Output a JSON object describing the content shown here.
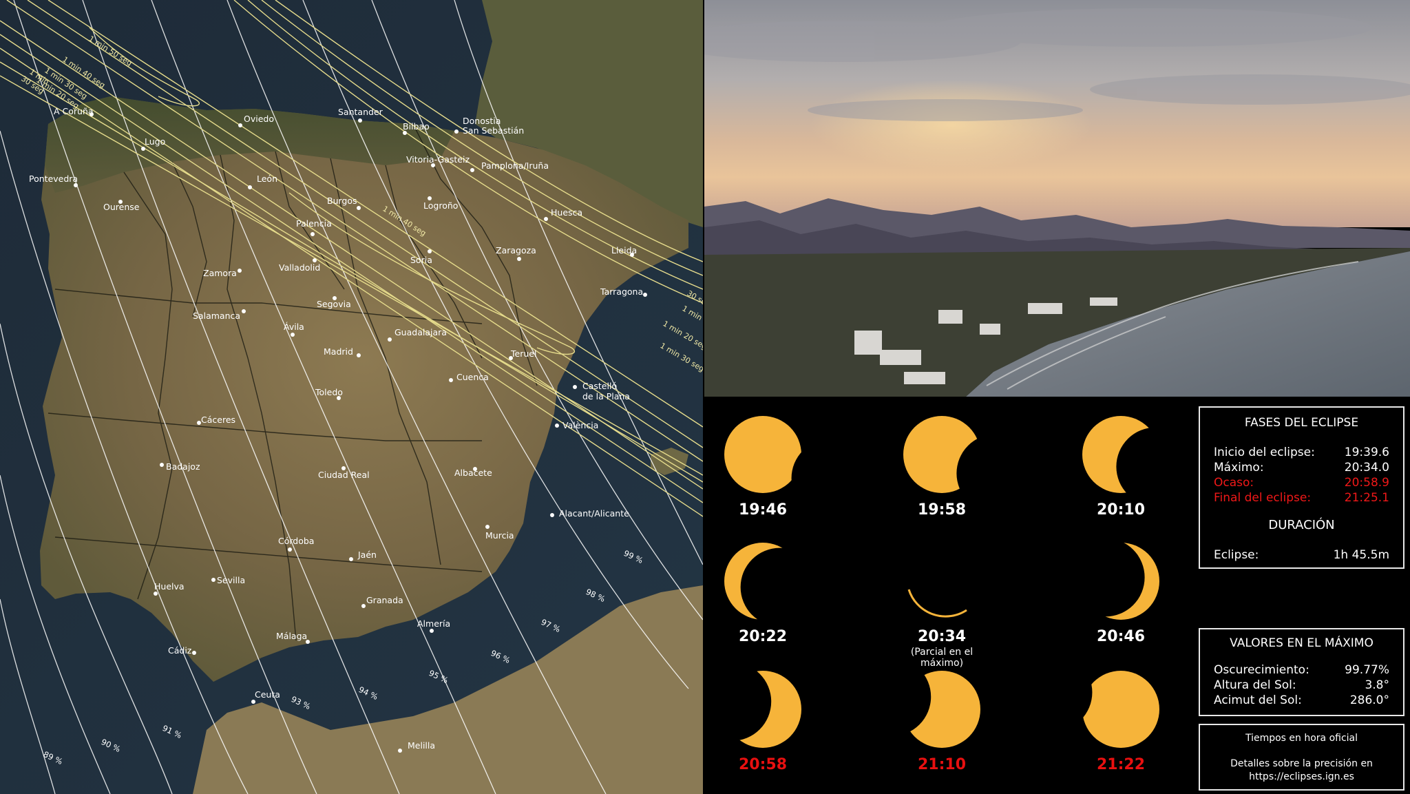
{
  "map": {
    "cities": [
      {
        "id": "a-coruna",
        "label": "A Coruña"
      },
      {
        "id": "oviedo",
        "label": "Oviedo"
      },
      {
        "id": "santander",
        "label": "Santander"
      },
      {
        "id": "bilbao",
        "label": "Bilbao"
      },
      {
        "id": "donostia",
        "label": "Donostia"
      },
      {
        "id": "san-sebastian",
        "label": "San Sebastián"
      },
      {
        "id": "lugo",
        "label": "Lugo"
      },
      {
        "id": "vitoria",
        "label": "Vitoria-Gasteiz"
      },
      {
        "id": "pamplona",
        "label": "Pamplona/Iruña"
      },
      {
        "id": "pontevedra",
        "label": "Pontevedra"
      },
      {
        "id": "leon",
        "label": "León"
      },
      {
        "id": "ourense",
        "label": "Ourense"
      },
      {
        "id": "burgos",
        "label": "Burgos"
      },
      {
        "id": "logrono",
        "label": "Logroño"
      },
      {
        "id": "huesca",
        "label": "Huesca"
      },
      {
        "id": "palencia",
        "label": "Palencia"
      },
      {
        "id": "lleida",
        "label": "Lleida"
      },
      {
        "id": "zaragoza",
        "label": "Zaragoza"
      },
      {
        "id": "soria",
        "label": "Soria"
      },
      {
        "id": "zamora",
        "label": "Zamora"
      },
      {
        "id": "valladolid",
        "label": "Valladolid"
      },
      {
        "id": "tarragona",
        "label": "Tarragona"
      },
      {
        "id": "segovia",
        "label": "Segovia"
      },
      {
        "id": "salamanca",
        "label": "Salamanca"
      },
      {
        "id": "guadalajara",
        "label": "Guadalajara"
      },
      {
        "id": "avila",
        "label": "Ávila"
      },
      {
        "id": "madrid",
        "label": "Madrid"
      },
      {
        "id": "teruel",
        "label": "Teruel"
      },
      {
        "id": "cuenca",
        "label": "Cuenca"
      },
      {
        "id": "castello",
        "label": "Castelló"
      },
      {
        "id": "de-la-plana",
        "label": "de la Plana"
      },
      {
        "id": "toledo",
        "label": "Toledo"
      },
      {
        "id": "caceres",
        "label": "Cáceres"
      },
      {
        "id": "valencia",
        "label": "València"
      },
      {
        "id": "badajoz",
        "label": "Badajoz"
      },
      {
        "id": "ciudad-real",
        "label": "Ciudad Real"
      },
      {
        "id": "albacete",
        "label": "Albacete"
      },
      {
        "id": "alicante",
        "label": "Alacant/Alicante"
      },
      {
        "id": "murcia",
        "label": "Murcia"
      },
      {
        "id": "cordoba",
        "label": "Córdoba"
      },
      {
        "id": "jaen",
        "label": "Jaén"
      },
      {
        "id": "sevilla",
        "label": "Sevilla"
      },
      {
        "id": "huelva",
        "label": "Huelva"
      },
      {
        "id": "granada",
        "label": "Granada"
      },
      {
        "id": "almeria",
        "label": "Almería"
      },
      {
        "id": "malaga",
        "label": "Málaga"
      },
      {
        "id": "cadiz",
        "label": "Cádiz"
      },
      {
        "id": "ceuta",
        "label": "Ceuta"
      },
      {
        "id": "melilla",
        "label": "Melilla"
      }
    ],
    "duration_labels": [
      {
        "id": "nw-1m50",
        "label": "1 min 50 seg"
      },
      {
        "id": "nw-1m40",
        "label": "1 min 40 seg"
      },
      {
        "id": "nw-1m30",
        "label": "1 min 30 seg"
      },
      {
        "id": "nw-1m20",
        "label": "1 min 20 seg"
      },
      {
        "id": "nw-1m10",
        "label": "1 min"
      },
      {
        "id": "nw-30",
        "label": "30 seg"
      },
      {
        "id": "center-1m40",
        "label": "1 min 40 seg"
      },
      {
        "id": "e-30",
        "label": "30 seg"
      },
      {
        "id": "e-1m",
        "label": "1 min"
      },
      {
        "id": "e-1m20",
        "label": "1 min 20 seg"
      },
      {
        "id": "e-1m30",
        "label": "1 min 30 seg"
      }
    ],
    "obscuration_labels": [
      {
        "id": "p99",
        "label": "99 %"
      },
      {
        "id": "p98",
        "label": "98 %"
      },
      {
        "id": "p97",
        "label": "97 %"
      },
      {
        "id": "p96",
        "label": "96 %"
      },
      {
        "id": "p95",
        "label": "95 %"
      },
      {
        "id": "p94",
        "label": "94 %"
      },
      {
        "id": "p93",
        "label": "93 %"
      },
      {
        "id": "p91",
        "label": "91 %"
      },
      {
        "id": "p90",
        "label": "90 %"
      },
      {
        "id": "p89",
        "label": "89 %"
      }
    ]
  },
  "phases": [
    {
      "time": "19:46",
      "note": "",
      "red": false,
      "coverage": 0.12
    },
    {
      "time": "19:58",
      "note": "",
      "red": false,
      "coverage": 0.3
    },
    {
      "time": "20:10",
      "note": "",
      "red": false,
      "coverage": 0.55
    },
    {
      "time": "20:22",
      "note": "",
      "red": false,
      "coverage": 0.78
    },
    {
      "time": "20:34",
      "note": "(Parcial en el máximo)",
      "red": false,
      "coverage": 0.9977
    },
    {
      "time": "20:46",
      "note": "",
      "red": false,
      "coverage": 0.8
    },
    {
      "time": "20:58",
      "note": "",
      "red": true,
      "coverage": 0.6
    },
    {
      "time": "21:10",
      "note": "",
      "red": true,
      "coverage": 0.35
    },
    {
      "time": "21:22",
      "note": "",
      "red": true,
      "coverage": 0.12
    }
  ],
  "fases_box": {
    "title": "FASES DEL ECLIPSE",
    "rows": [
      {
        "label": "Inicio del eclipse:",
        "value": "19:39.6",
        "red": false
      },
      {
        "label": "Máximo:",
        "value": "20:34.0",
        "red": false
      },
      {
        "label": "Ocaso:",
        "value": "20:58.9",
        "red": true
      },
      {
        "label": "Final del eclipse:",
        "value": "21:25.1",
        "red": true
      }
    ],
    "duration_title": "DURACIÓN",
    "duration_label": "Eclipse:",
    "duration_value": "1h 45.5m"
  },
  "maximo_box": {
    "title": "VALORES EN EL MÁXIMO",
    "rows": [
      {
        "label": "Oscurecimiento:",
        "value": "99.77%"
      },
      {
        "label": "Altura del Sol:",
        "value": "3.8°"
      },
      {
        "label": "Acimut del Sol:",
        "value": "286.0°"
      }
    ]
  },
  "notes_box": {
    "line1": "Tiempos en hora oficial",
    "line2": "Detalles sobre la precisión en",
    "line3": "https://eclipses.ign.es"
  },
  "colors": {
    "sun": "#f6b43a",
    "sea": "#1d2a36",
    "land": "#7c6a45",
    "path_line": "#e6dc8c",
    "red": "#e81010"
  }
}
